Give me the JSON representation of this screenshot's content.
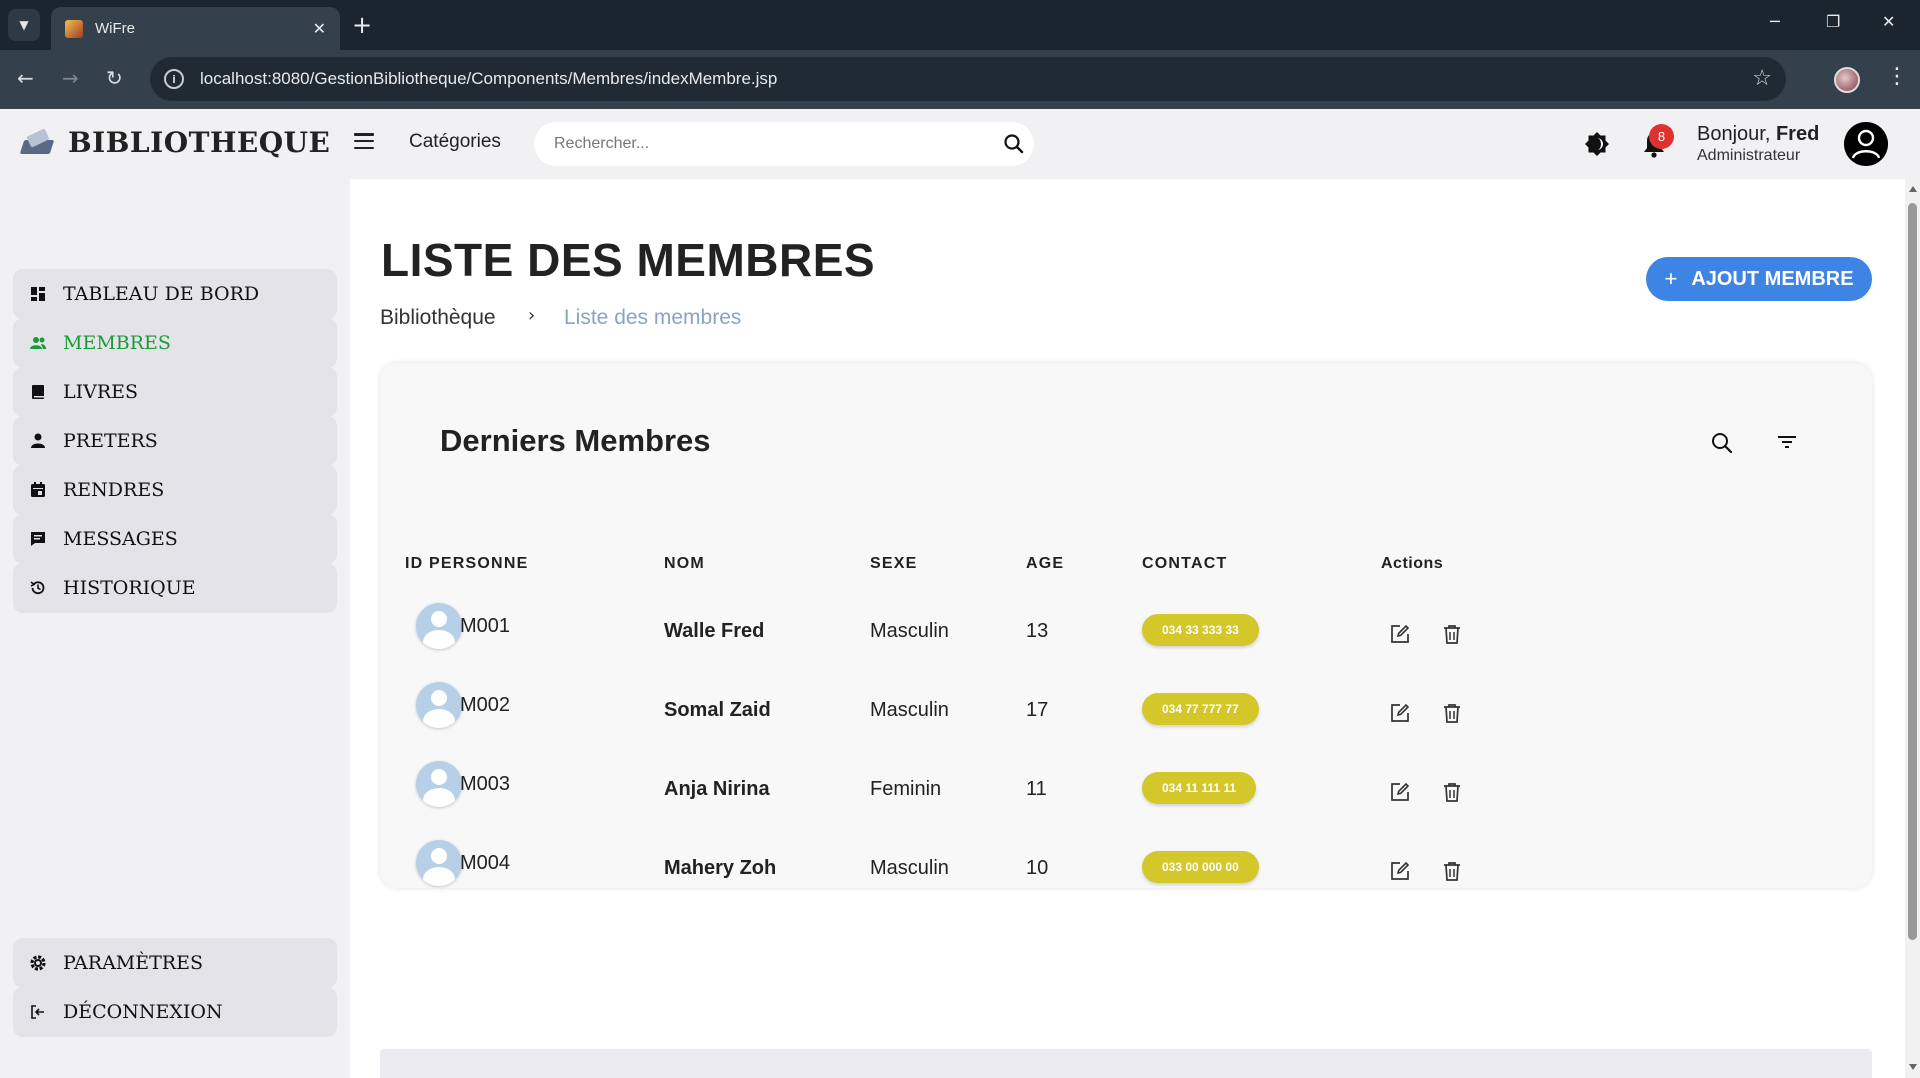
{
  "browser": {
    "tab_title": "WiFre",
    "url": "localhost:8080/GestionBibliotheque/Components/Membres/indexMembre.jsp"
  },
  "header": {
    "brand": "BIBLIOTHEQUE",
    "categories_label": "Catégories",
    "search_placeholder": "Rechercher...",
    "notification_count": "8",
    "greeting_prefix": "Bonjour, ",
    "user_name": "Fred",
    "user_role": "Administrateur"
  },
  "sidebar": {
    "items": [
      {
        "label": "TABLEAU DE BORD",
        "icon": "dashboard-icon",
        "active": false
      },
      {
        "label": "MEMBRES",
        "icon": "members-icon",
        "active": true
      },
      {
        "label": "LIVRES",
        "icon": "book-icon",
        "active": false
      },
      {
        "label": "PRETERS",
        "icon": "person-icon",
        "active": false
      },
      {
        "label": "RENDRES",
        "icon": "calendar-icon",
        "active": false
      },
      {
        "label": "MESSAGES",
        "icon": "message-icon",
        "active": false
      },
      {
        "label": "HISTORIQUE",
        "icon": "history-icon",
        "active": false
      }
    ],
    "bottom_items": [
      {
        "label": "PARAMÈTRES",
        "icon": "gear-icon"
      },
      {
        "label": "DÉCONNEXION",
        "icon": "logout-icon"
      }
    ],
    "active_color": "#1a9b35"
  },
  "main": {
    "title": "LISTE DES MEMBRES",
    "breadcrumb": {
      "home": "Bibliothèque",
      "separator": "›",
      "current": "Liste des membres"
    },
    "add_button_label": "AJOUT MEMBRE",
    "add_button_icon": "+",
    "card_title": "Derniers Membres",
    "columns": [
      "ID PERSONNE",
      "NOM",
      "SEXE",
      "AGE",
      "CONTACT",
      "Actions"
    ],
    "rows": [
      {
        "id": "M001",
        "nom": "Walle Fred",
        "sexe": "Masculin",
        "age": "13",
        "contact": "034 33 333 33"
      },
      {
        "id": "M002",
        "nom": "Somal Zaid",
        "sexe": "Masculin",
        "age": "17",
        "contact": "034 77 777 77"
      },
      {
        "id": "M003",
        "nom": "Anja Nirina",
        "sexe": "Feminin",
        "age": "11",
        "contact": "034 11 111 11"
      },
      {
        "id": "M004",
        "nom": "Mahery Zoh",
        "sexe": "Masculin",
        "age": "10",
        "contact": "033 00 000 00"
      }
    ],
    "accent_color": "#3d84e5",
    "contact_badge_color": "#d4c72a"
  }
}
